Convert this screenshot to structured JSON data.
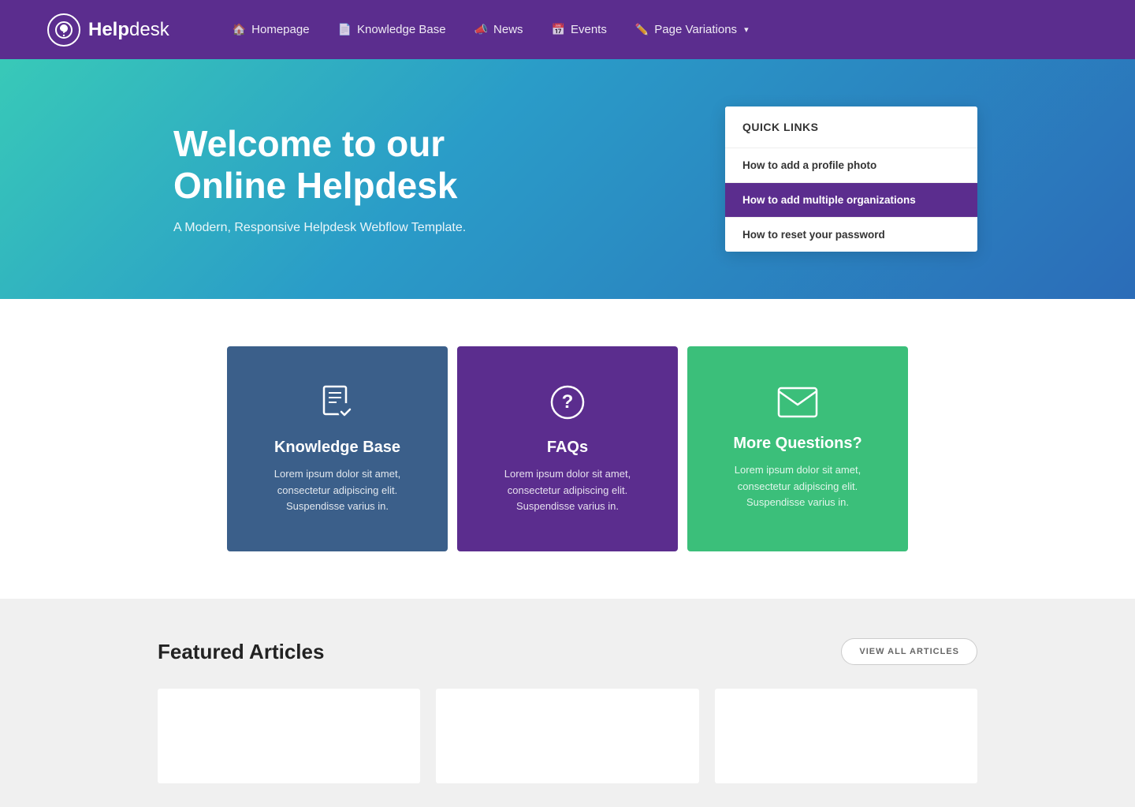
{
  "header": {
    "logo_text_bold": "Help",
    "logo_text_light": "desk",
    "nav": [
      {
        "id": "homepage",
        "label": "Homepage",
        "icon": "🏠"
      },
      {
        "id": "knowledge-base",
        "label": "Knowledge Base",
        "icon": "📄"
      },
      {
        "id": "news",
        "label": "News",
        "icon": "📣"
      },
      {
        "id": "events",
        "label": "Events",
        "icon": "📅"
      },
      {
        "id": "page-variations",
        "label": "Page Variations",
        "icon": "✏️",
        "has_dropdown": true
      }
    ]
  },
  "hero": {
    "title_line1": "Welcome to our",
    "title_line2": "Online Helpdesk",
    "subtitle": "A Modern, Responsive Helpdesk Webflow Template.",
    "quick_links": {
      "header": "QUICK LINKS",
      "items": [
        {
          "label": "How to add a profile photo"
        },
        {
          "label": "How to add multiple organizations"
        },
        {
          "label": "How to reset your password"
        }
      ]
    }
  },
  "cards": [
    {
      "id": "knowledge-base",
      "title": "Knowledge Base",
      "desc": "Lorem ipsum dolor sit amet, consectetur adipiscing elit. Suspendisse varius in.",
      "color": "kb"
    },
    {
      "id": "faqs",
      "title": "FAQs",
      "desc": "Lorem ipsum dolor sit amet, consectetur adipiscing elit. Suspendisse varius in.",
      "color": "faq"
    },
    {
      "id": "more-questions",
      "title": "More Questions?",
      "desc": "Lorem ipsum dolor sit amet, consectetur adipiscing elit. Suspendisse varius in.",
      "color": "contact"
    }
  ],
  "featured": {
    "title": "Featured Articles",
    "view_all_label": "VIEW ALL ARTICLES"
  }
}
